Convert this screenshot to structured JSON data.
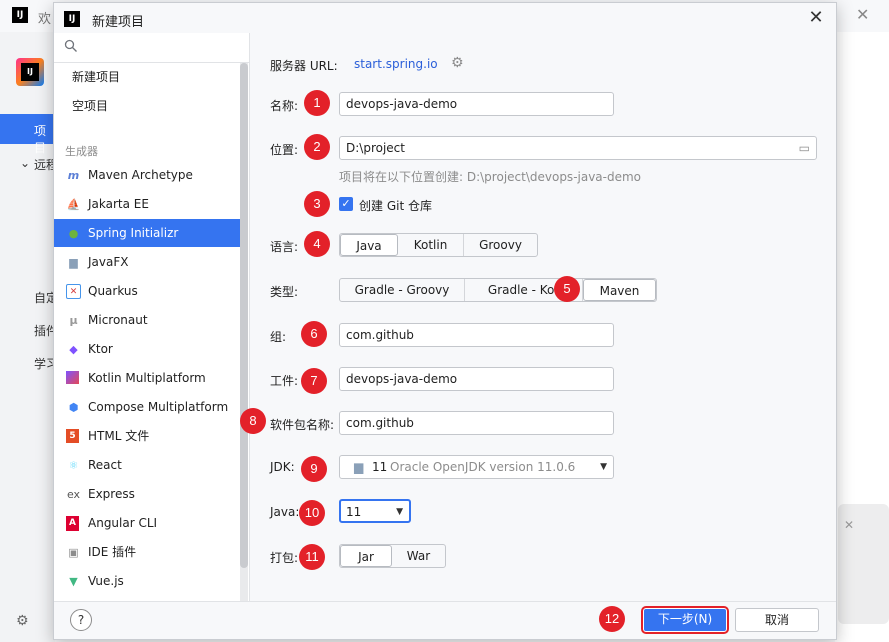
{
  "background": {
    "title": "欢",
    "projects_label": "项目",
    "remote_label": "远程",
    "custom_label": "自定",
    "plugins_label": "插件",
    "learn_label": "学习"
  },
  "dialog": {
    "title": "新建项目",
    "icon_text": "IJ"
  },
  "sidebar": {
    "top_items": [
      {
        "label": "新建项目"
      },
      {
        "label": "空项目"
      }
    ],
    "generators_header": "生成器",
    "generators": [
      {
        "label": "Maven Archetype",
        "icon": "maven-icon"
      },
      {
        "label": "Jakarta EE",
        "icon": "jakarta-icon"
      },
      {
        "label": "Spring Initializr",
        "icon": "spring-icon",
        "selected": true
      },
      {
        "label": "JavaFX",
        "icon": "javafx-icon"
      },
      {
        "label": "Quarkus",
        "icon": "quarkus-icon"
      },
      {
        "label": "Micronaut",
        "icon": "micronaut-icon"
      },
      {
        "label": "Ktor",
        "icon": "ktor-icon"
      },
      {
        "label": "Kotlin Multiplatform",
        "icon": "kotlin-icon"
      },
      {
        "label": "Compose Multiplatform",
        "icon": "compose-icon"
      },
      {
        "label": "HTML 文件",
        "icon": "html5-icon"
      },
      {
        "label": "React",
        "icon": "react-icon"
      },
      {
        "label": "Express",
        "icon": "express-icon"
      },
      {
        "label": "Angular CLI",
        "icon": "angular-icon"
      },
      {
        "label": "IDE 插件",
        "icon": "ide-plugin-icon"
      },
      {
        "label": "Vue.js",
        "icon": "vue-icon"
      }
    ]
  },
  "form": {
    "server_url_label": "服务器 URL:",
    "server_url_value": "start.spring.io",
    "name_label": "名称:",
    "name_value": "devops-java-demo",
    "location_label": "位置:",
    "location_value": "D:\\project",
    "location_hint": "项目将在以下位置创建: D:\\project\\devops-java-demo",
    "git_label": "创建 Git 仓库",
    "git_checked": true,
    "language_label": "语言:",
    "languages": [
      "Java",
      "Kotlin",
      "Groovy"
    ],
    "language_selected": "Java",
    "type_label": "类型:",
    "types": [
      "Gradle - Groovy",
      "Gradle - Kot",
      "Maven"
    ],
    "type_selected": "Maven",
    "group_label": "组:",
    "group_value": "com.github",
    "artifact_label": "工件:",
    "artifact_value": "devops-java-demo",
    "package_label": "软件包名称:",
    "package_value": "com.github",
    "jdk_label": "JDK:",
    "jdk_version": "11",
    "jdk_name": "Oracle OpenJDK version 11.0.6",
    "java_label": "Java:",
    "java_value": "11",
    "packaging_label": "打包:",
    "packaging": [
      "Jar",
      "War"
    ],
    "packaging_selected": "Jar"
  },
  "markers": [
    "1",
    "2",
    "3",
    "4",
    "5",
    "6",
    "7",
    "8",
    "9",
    "10",
    "11",
    "12"
  ],
  "footer": {
    "help_label": "?",
    "next_label": "下一步(N)",
    "cancel_label": "取消"
  },
  "colors": {
    "accent": "#3574f0",
    "marker": "#e32129"
  }
}
